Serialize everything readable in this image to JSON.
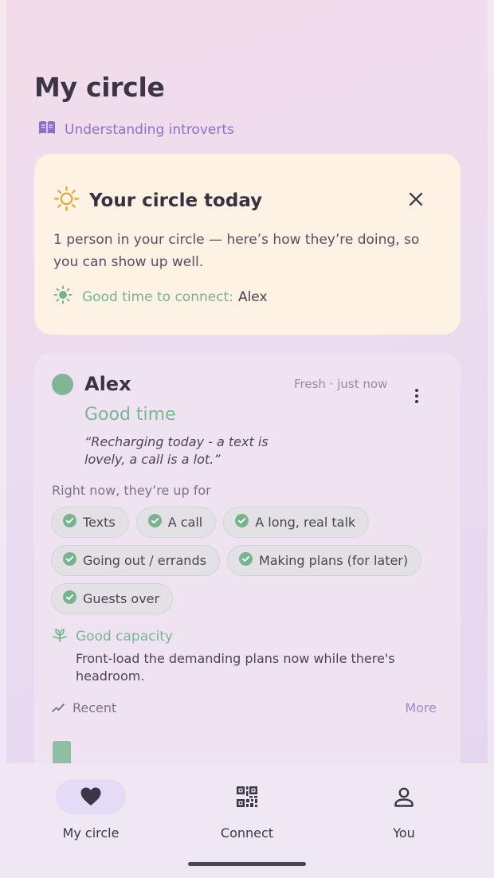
{
  "header": {
    "title": "My circle",
    "guide_link": "Understanding introverts"
  },
  "today_card": {
    "title": "Your circle today",
    "description": "1 person in your circle — here’s how they’re doing, so you can show up well.",
    "connect_label": "Good time to connect:",
    "connect_name": "Alex"
  },
  "person": {
    "name": "Alex",
    "freshness": "Fresh · just now",
    "mood": "Good time",
    "quote": "“Recharging today - a text is lovely, a call is a lot.”",
    "up_for_label": "Right now, they’re up for",
    "activities": [
      "Texts",
      "A call",
      "A long, real talk",
      "Going out / errands",
      "Making plans (for later)",
      "Guests over"
    ],
    "capacity_label": "Good capacity",
    "capacity_tip": "Front-load the demanding plans now while there's headroom.",
    "recent_label": "Recent",
    "more_label": "More"
  },
  "nav": {
    "items": [
      {
        "label": "My circle",
        "icon": "heart-icon",
        "active": true
      },
      {
        "label": "Connect",
        "icon": "qr-code-icon",
        "active": false
      },
      {
        "label": "You",
        "icon": "person-icon",
        "active": false
      }
    ]
  },
  "colors": {
    "accent_green": "#7ab692",
    "accent_purple": "#8a72c8",
    "today_card_bg": "#fdf2e4",
    "person_card_bg": "#efe3f2"
  }
}
